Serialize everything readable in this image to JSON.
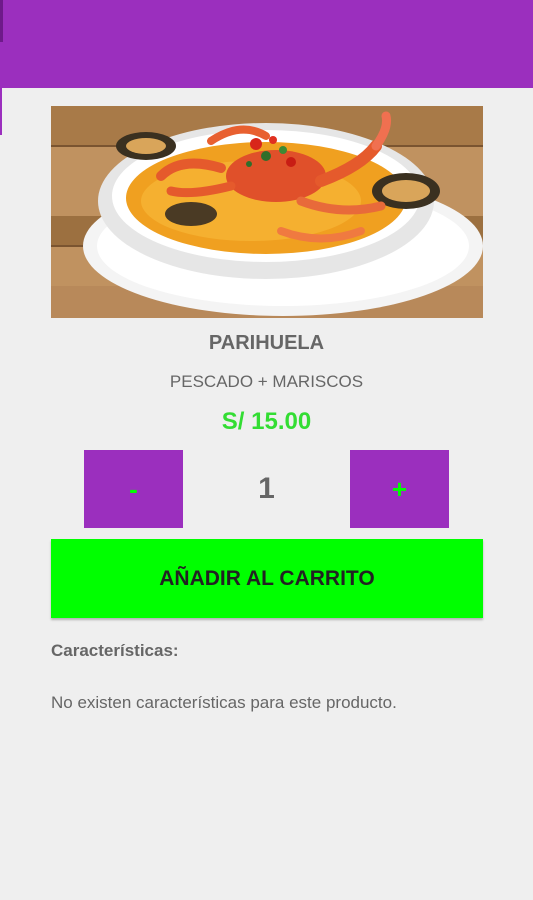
{
  "theme": {
    "primary": "#9b2fbe",
    "accent_green": "#00ff00",
    "price_green": "#33dd33",
    "text_gray": "#666666",
    "background": "#efefef"
  },
  "product": {
    "image_icon": "seafood-dish-photo",
    "name": "PARIHUELA",
    "subtitle": "PESCADO + MARISCOS",
    "price": "S/ 15.00"
  },
  "quantity": {
    "minus_label": "-",
    "value": "1",
    "plus_label": "+"
  },
  "cart": {
    "add_label": "AÑADIR AL CARRITO"
  },
  "features": {
    "heading": "Características:",
    "text": "No existen características para este producto."
  }
}
